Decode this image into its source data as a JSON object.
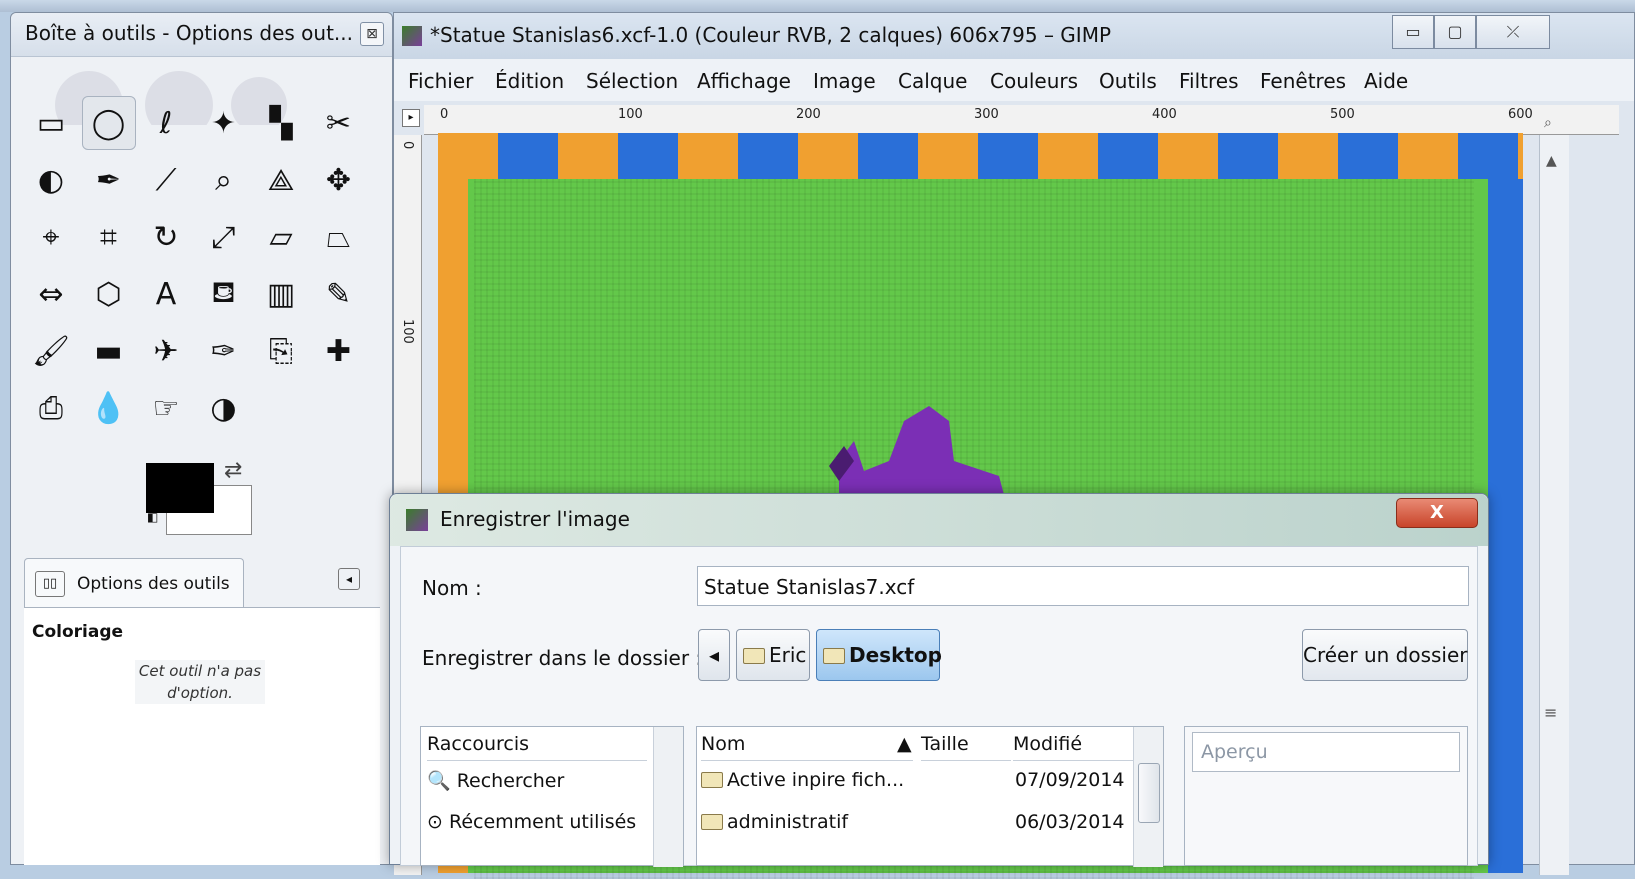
{
  "toolbox": {
    "title": "Boîte à outils - Options des out...",
    "close": "⊠",
    "tools": [
      "rect-select",
      "ellipse-select",
      "free-select",
      "fuzzy-select",
      "color-select",
      "scissors",
      "foreground-select",
      "paths",
      "color-picker",
      "zoom",
      "measure",
      "move",
      "align",
      "crop",
      "rotate",
      "scale",
      "shear",
      "perspective",
      "flip",
      "cage",
      "text",
      "bucket-fill",
      "blend",
      "pencil",
      "paintbrush",
      "eraser",
      "airbrush",
      "ink",
      "clone",
      "heal",
      "perspective-clone",
      "blur",
      "smudge",
      "dodge-burn"
    ],
    "options_tab": "Options des outils",
    "options_heading": "Coloriage",
    "options_message": "Cet outil n'a pas d'option."
  },
  "image_window": {
    "title": "*Statue Stanislas6.xcf-1.0 (Couleur RVB, 2 calques) 606x795 – GIMP",
    "menu": [
      "Fichier",
      "Édition",
      "Sélection",
      "Affichage",
      "Image",
      "Calque",
      "Couleurs",
      "Outils",
      "Filtres",
      "Fenêtres",
      "Aide"
    ],
    "ruler_h": [
      "0",
      "100",
      "200",
      "300",
      "400",
      "500",
      "600"
    ],
    "ruler_v": [
      "0",
      "100"
    ]
  },
  "dialog": {
    "title": "Enregistrer l'image",
    "close": "X",
    "name_label": "Nom :",
    "name_value": "Statue Stanislas7.xcf",
    "folder_label": "Enregistrer dans le dossier :",
    "crumb_back": "◂",
    "crumbs": [
      "Eric",
      "Desktop"
    ],
    "create_folder": "Créer un dossier",
    "places_header": "Raccourcis",
    "places": [
      "Rechercher",
      "Récemment utilisés"
    ],
    "files_headers": {
      "name": "Nom",
      "size": "Taille",
      "modified": "Modifié"
    },
    "files": [
      {
        "name": "Active inpire fich...",
        "modified": "07/09/2014"
      },
      {
        "name": "administratif",
        "modified": "06/03/2014"
      }
    ],
    "preview_label": "Aperçu"
  },
  "colors": {
    "canvas_green": "#63c84a",
    "accent_orange": "#f0a030",
    "accent_blue": "#2a6fd8",
    "statue_purple": "#7b2fb5"
  }
}
